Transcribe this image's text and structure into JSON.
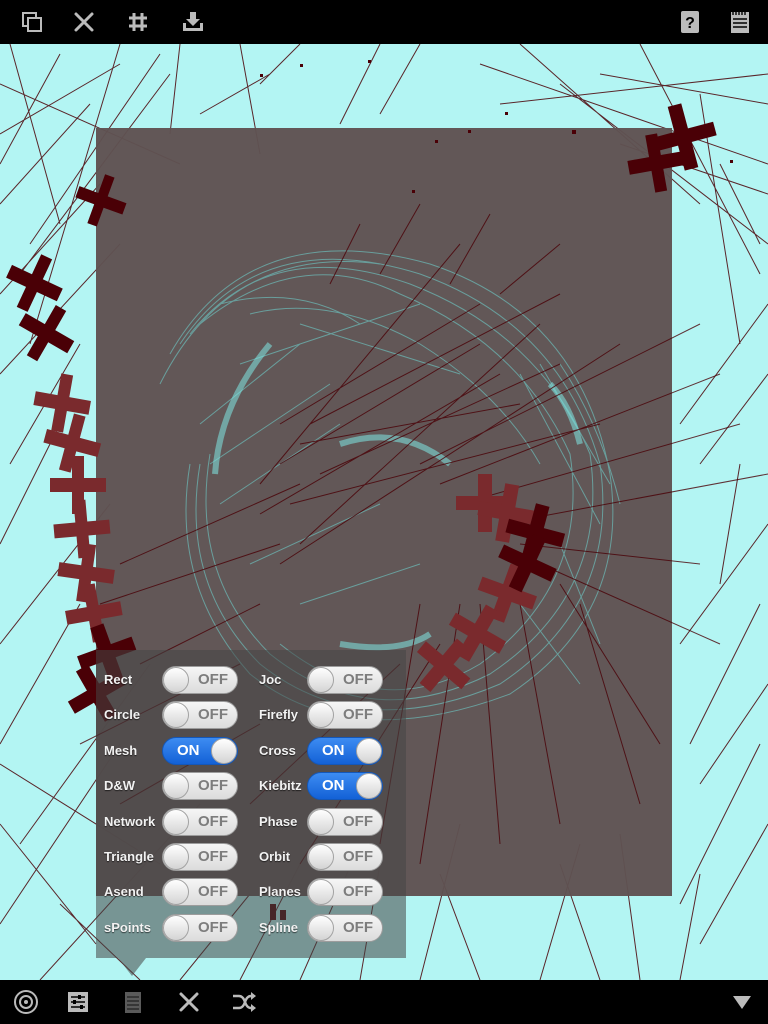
{
  "toolbar_top": {
    "left_buttons": [
      {
        "icon": "duplicate-icon"
      },
      {
        "icon": "close-icon"
      },
      {
        "icon": "grid-icon"
      },
      {
        "icon": "save-to-tray-icon"
      }
    ],
    "right_buttons": [
      {
        "icon": "help-icon",
        "glyph": "?"
      },
      {
        "icon": "notepad-icon"
      }
    ]
  },
  "toolbar_bottom": {
    "left_buttons": [
      {
        "icon": "target-icon"
      },
      {
        "icon": "sliders-icon"
      },
      {
        "icon": "notes-icon"
      },
      {
        "icon": "close-icon"
      },
      {
        "icon": "shuffle-icon"
      }
    ],
    "right_buttons": [
      {
        "icon": "dropdown-triangle-icon"
      }
    ]
  },
  "colors": {
    "canvas_bg": "#b3f5f3",
    "dark_red": "#4a0006",
    "mid_red": "#7a2a2d",
    "square_overlay": "#5f5252",
    "teal": "#6fd9d5",
    "switch_on": "#1a6fe0"
  },
  "switches": {
    "left": [
      {
        "label": "Rect",
        "state": "OFF"
      },
      {
        "label": "Circle",
        "state": "OFF"
      },
      {
        "label": "Mesh",
        "state": "ON"
      },
      {
        "label": "D&W",
        "state": "OFF"
      },
      {
        "label": "Network",
        "state": "OFF"
      },
      {
        "label": "Triangle",
        "state": "OFF"
      },
      {
        "label": "Asend",
        "state": "OFF"
      },
      {
        "label": "sPoints",
        "state": "OFF"
      }
    ],
    "right": [
      {
        "label": "Joc",
        "state": "OFF"
      },
      {
        "label": "Firefly",
        "state": "OFF"
      },
      {
        "label": "Cross",
        "state": "ON"
      },
      {
        "label": "Kiebitz",
        "state": "ON"
      },
      {
        "label": "Phase",
        "state": "OFF"
      },
      {
        "label": "Orbit",
        "state": "OFF"
      },
      {
        "label": "Planes",
        "state": "OFF"
      },
      {
        "label": "Spline",
        "state": "OFF"
      }
    ]
  }
}
